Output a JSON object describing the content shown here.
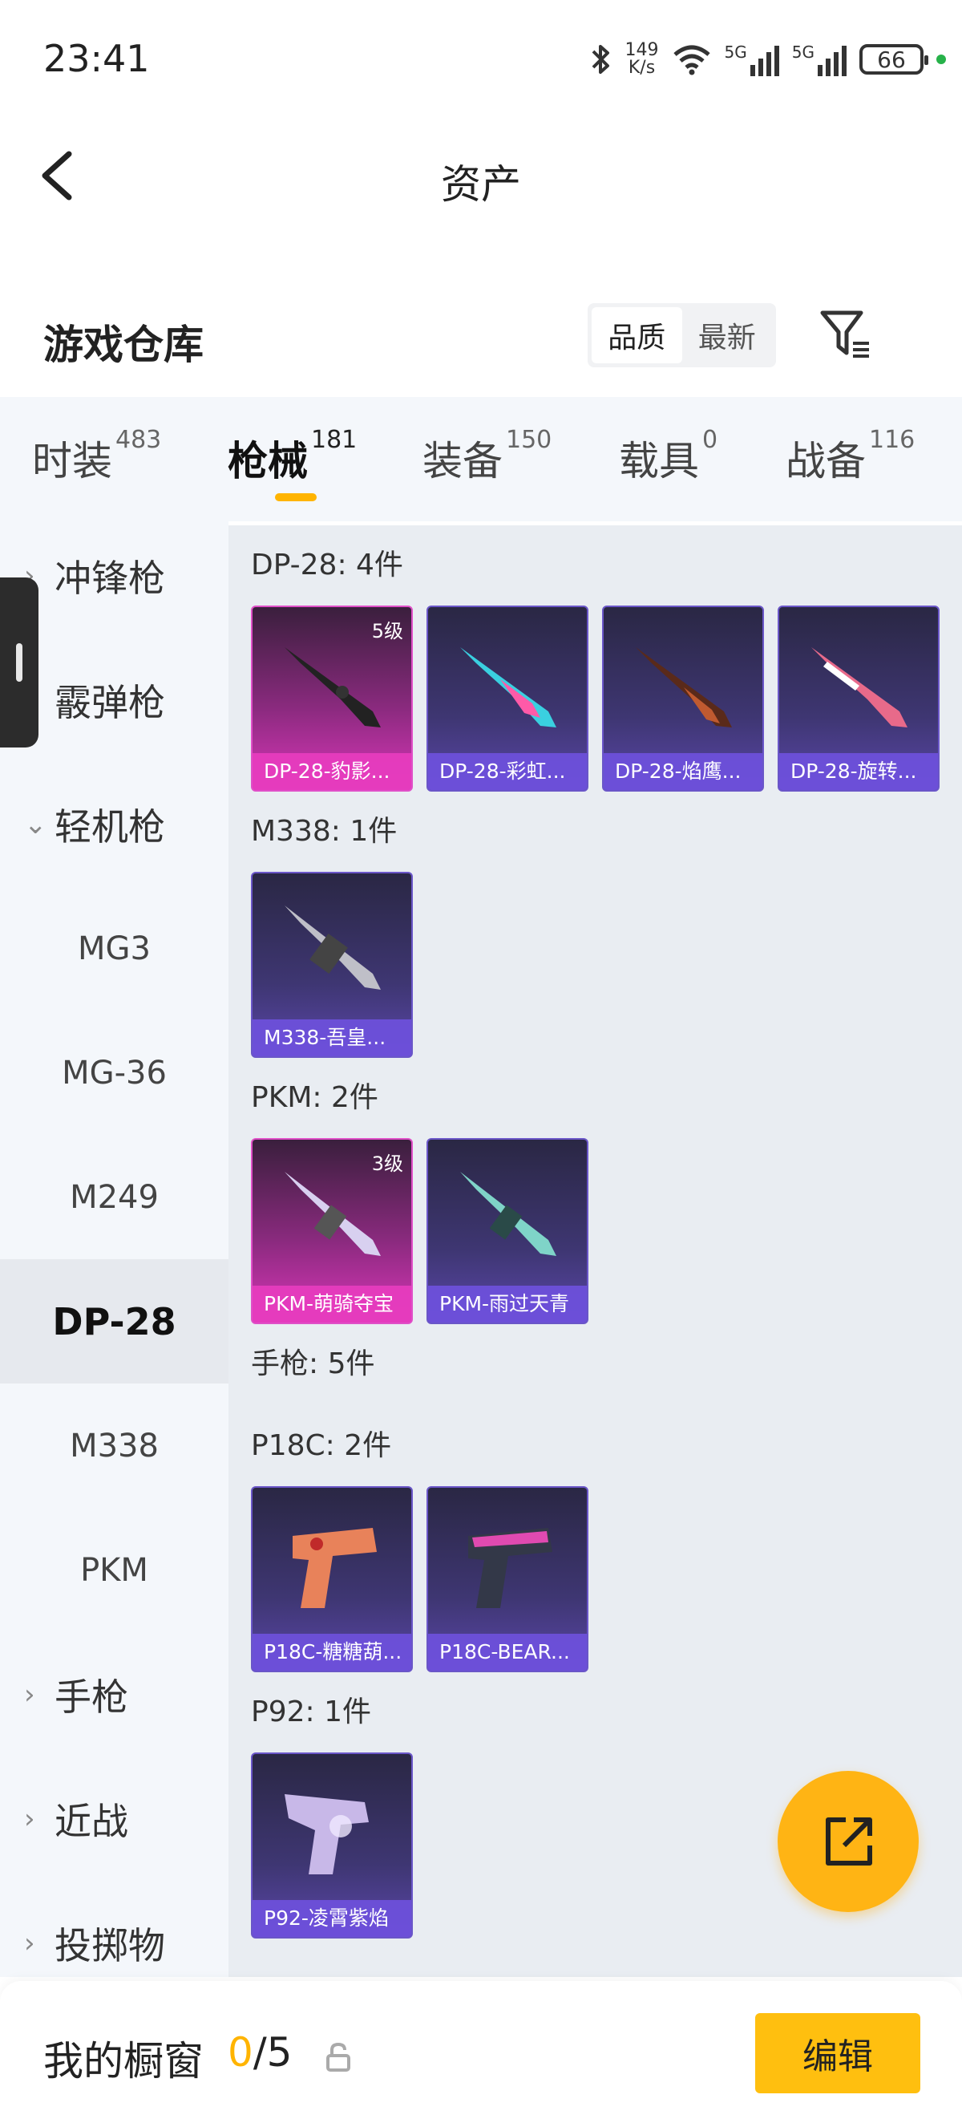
{
  "status_bar": {
    "time": "23:41",
    "net_speed_value": "149",
    "net_speed_unit": "K/s",
    "battery": "66",
    "signal_1": "5G",
    "signal_2": "5G",
    "icons": [
      "bluetooth-icon",
      "wifi-icon",
      "signal-icon",
      "battery-icon"
    ]
  },
  "header": {
    "title": "资产"
  },
  "warehouse": {
    "title": "游戏仓库",
    "sort_options": [
      "品质",
      "最新"
    ],
    "sort_selected": "品质"
  },
  "tabs": [
    {
      "label": "时装",
      "count": "483"
    },
    {
      "label": "枪械",
      "count": "181",
      "active": true
    },
    {
      "label": "装备",
      "count": "150"
    },
    {
      "label": "载具",
      "count": "0"
    },
    {
      "label": "战备",
      "count": "116"
    }
  ],
  "sidebar": [
    {
      "label": "冲锋枪",
      "type": "category",
      "expanded": false
    },
    {
      "label": "霰弹枪",
      "type": "category"
    },
    {
      "label": "轻机枪",
      "type": "category",
      "expanded": true
    },
    {
      "label": "MG3",
      "type": "sub"
    },
    {
      "label": "MG-36",
      "type": "sub"
    },
    {
      "label": "M249",
      "type": "sub"
    },
    {
      "label": "DP-28",
      "type": "sub",
      "selected": true
    },
    {
      "label": "M338",
      "type": "sub"
    },
    {
      "label": "PKM",
      "type": "sub"
    },
    {
      "label": "手枪",
      "type": "category",
      "expanded": false
    },
    {
      "label": "近战",
      "type": "category",
      "expanded": false
    },
    {
      "label": "投掷物",
      "type": "category",
      "expanded": false
    }
  ],
  "groups": [
    {
      "label": "DP-28: 4件",
      "items": [
        {
          "name": "DP-28-豹影...",
          "level": "5级",
          "rarity": "pink"
        },
        {
          "name": "DP-28-彩虹...",
          "rarity": "purple"
        },
        {
          "name": "DP-28-焰鹰...",
          "rarity": "purple"
        },
        {
          "name": "DP-28-旋转...",
          "rarity": "purple"
        }
      ]
    },
    {
      "label": "M338: 1件",
      "items": [
        {
          "name": "M338-吾皇...",
          "rarity": "purple"
        }
      ]
    },
    {
      "label": "PKM: 2件",
      "items": [
        {
          "name": "PKM-萌骑夺宝",
          "level": "3级",
          "rarity": "pink"
        },
        {
          "name": "PKM-雨过天青",
          "rarity": "purple"
        }
      ]
    },
    {
      "label": "手枪: 5件",
      "items": []
    },
    {
      "label": "P18C: 2件",
      "items": [
        {
          "name": "P18C-糖糖葫...",
          "rarity": "purple"
        },
        {
          "name": "P18C-BEAR...",
          "rarity": "purple"
        }
      ]
    },
    {
      "label": "P92: 1件",
      "items": [
        {
          "name": "P92-凌霄紫焰",
          "rarity": "purple"
        }
      ]
    }
  ],
  "bottom_bar": {
    "showcase_label": "我的橱窗",
    "current": "0",
    "separator": "/",
    "max": "5",
    "edit_label": "编辑"
  },
  "colors": {
    "accent": "#ffb400",
    "pink_rarity": "#d936b8",
    "purple_rarity": "#5a46a8"
  }
}
